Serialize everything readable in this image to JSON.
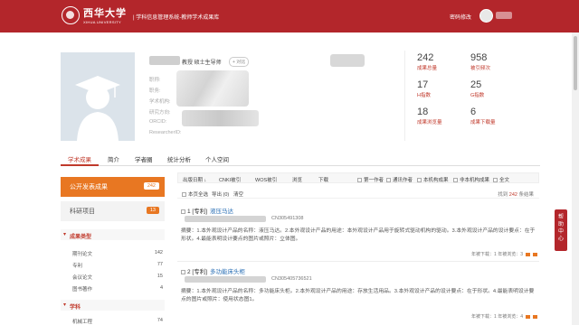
{
  "header": {
    "brand": "西华大学",
    "brand_sub": "XIHUA UNIVERSITY",
    "system_title": "| 学科信息管理系统-教师学术成果库",
    "change_password": "密码修改"
  },
  "profile": {
    "title": "教授   硕士生导师",
    "tag": "+ 对比",
    "labels": [
      "职称:",
      "职务:",
      "学术机构:",
      "研究方向:",
      "ORCID:",
      "ResearcherID:"
    ]
  },
  "stats": [
    {
      "value": "242",
      "label": "成果总量"
    },
    {
      "value": "958",
      "label": "被引频次"
    },
    {
      "value": "17",
      "label": "H指数"
    },
    {
      "value": "25",
      "label": "G指数"
    },
    {
      "value": "18",
      "label": "成果浏览量"
    },
    {
      "value": "6",
      "label": "成果下载量"
    }
  ],
  "tabs": [
    "学术成果",
    "简介",
    "学者圈",
    "统计分析",
    "个人空间"
  ],
  "sidebar": {
    "published": {
      "label": "公开发表成果",
      "count": "242"
    },
    "projects": {
      "label": "科研项目",
      "count": "13"
    },
    "groups": [
      {
        "title": "成果类型",
        "items": [
          {
            "label": "期刊论文",
            "count": "142"
          },
          {
            "label": "专利",
            "count": "77"
          },
          {
            "label": "会议论文",
            "count": "15"
          },
          {
            "label": "图书著作",
            "count": "4"
          }
        ]
      },
      {
        "title": "学科",
        "items": [
          {
            "label": "机械工程",
            "count": "74"
          }
        ]
      }
    ]
  },
  "toolbar": {
    "publish_date": "出版日期",
    "sort_icon": "↓",
    "cnki": "CNKI被引",
    "wos": "WOS被引",
    "views": "浏览",
    "downloads": "下载",
    "first_author": "第一作者",
    "corresponding": "通讯作者",
    "this_inst": "本机构成果",
    "other_inst": "非本机构成果",
    "all": "全文",
    "select_page": "本页全选",
    "export": "导出 (0)",
    "clear": "清空",
    "found_prefix": "找到",
    "found_count": "242",
    "found_suffix": "条结果"
  },
  "records": [
    {
      "index": "1 [专利]",
      "title": "液压马达",
      "code": "CN305491308",
      "abstract": "摘要：1.本外观设计产品的名称：液压马达。2.本外观设计产品的用途：本外观设计产品用于旋转式驱动机构的驱动。3.本外观设计产品的设计要点：在于形状。4.最能表明设计要点的图片或照片：立体图。",
      "meta": "年被下载：1   年被浏览：3"
    },
    {
      "index": "2 [专利]",
      "title": "多功能床头柜",
      "code": "CN305405736521",
      "abstract": "摘要：1.本外观设计产品的名称：多功能床头柜。2.本外观设计产品的用途：存放生活用品。3.本外观设计产品的设计要点：在于形状。4.最能表明设计要点的图片或照片：使用状态图1。",
      "meta": "年被下载：1   年被浏览：4"
    }
  ],
  "help": "帮助中心"
}
